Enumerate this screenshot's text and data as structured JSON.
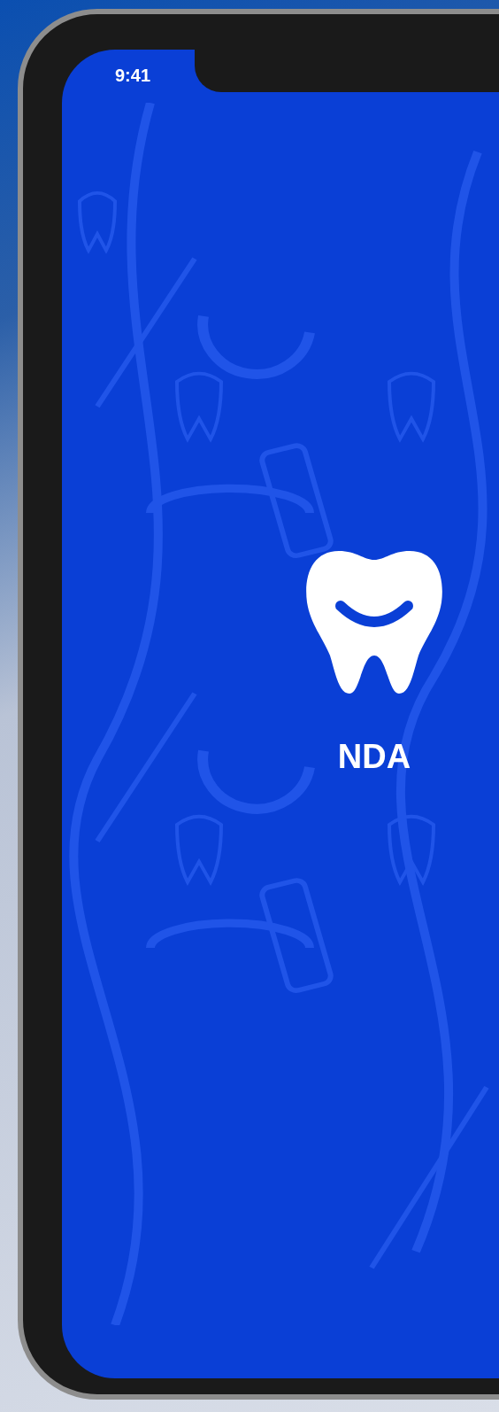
{
  "status_bar": {
    "time": "9:41"
  },
  "splash": {
    "app_name": "NDA"
  }
}
